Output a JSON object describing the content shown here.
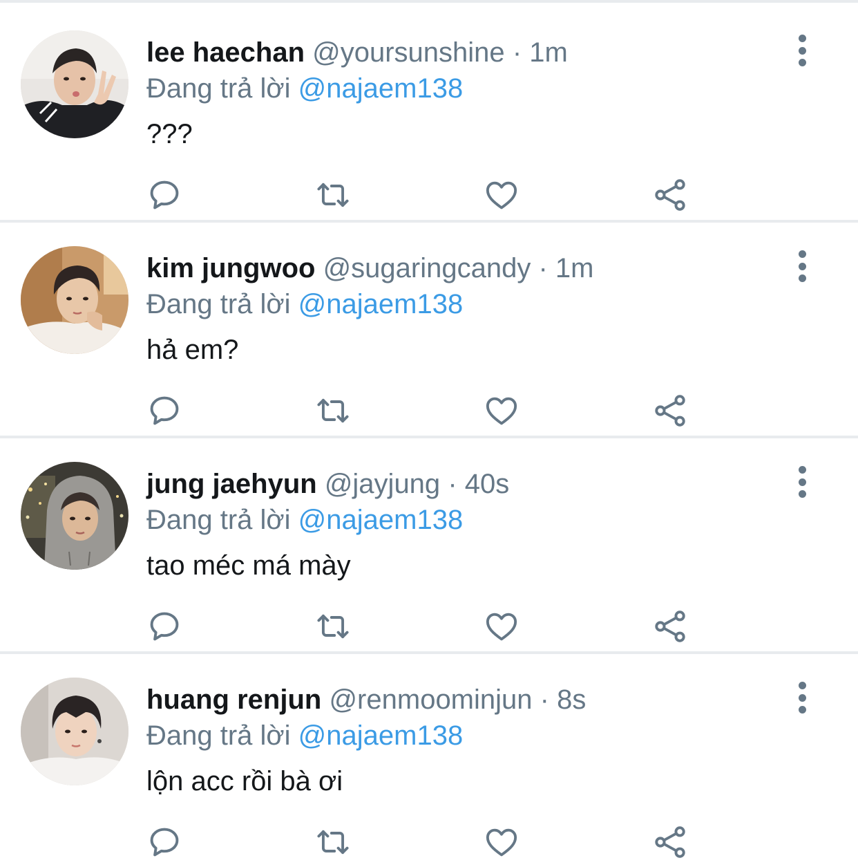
{
  "tweets": [
    {
      "name": "lee haechan",
      "handle": "@yoursunshine",
      "separator": "·",
      "time": "1m",
      "replying_label": "Đang trả lời",
      "replying_to": "@najaem138",
      "text": "???"
    },
    {
      "name": "kim jungwoo",
      "handle": "@sugaringcandy",
      "separator": "·",
      "time": "1m",
      "replying_label": "Đang trả lời",
      "replying_to": "@najaem138",
      "text": "hả em?"
    },
    {
      "name": "jung jaehyun",
      "handle": "@jayjung",
      "separator": "·",
      "time": "40s",
      "replying_label": "Đang trả lời",
      "replying_to": "@najaem138",
      "text": "tao méc má mày"
    },
    {
      "name": "huang renjun",
      "handle": "@renmoominjun",
      "separator": "·",
      "time": "8s",
      "replying_label": "Đang trả lời",
      "replying_to": "@najaem138",
      "text": "lộn acc rồi bà ơi"
    }
  ],
  "icons": {
    "reply": "reply-icon",
    "retweet": "retweet-icon",
    "like": "heart-icon",
    "share": "share-icon",
    "menu": "more-vertical-icon"
  },
  "colors": {
    "text": "#14171a",
    "muted": "#657786",
    "mention": "#3b9be5",
    "divider": "#e8ebee"
  }
}
